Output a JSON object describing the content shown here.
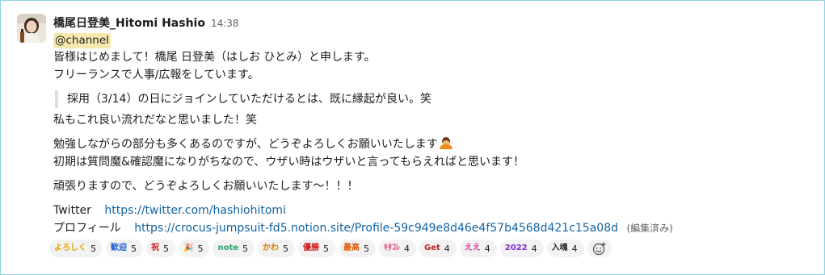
{
  "message": {
    "author": "橋尾日登美_Hitomi Hashio",
    "time": "14:38",
    "mention": "@channel",
    "lines1": [
      "皆様はじめまして！橋尾 日登美（はしお ひとみ）と申します。",
      "フリーランスで人事/広報をしています。"
    ],
    "quote": "採用（3/14）の日にジョインしていただけるとは、既に縁起が良い。笑",
    "after_quote": "私もこれ良い流れだなと思いました！笑",
    "para2_line1": "勉強しながらの部分も多くあるのですが、どうぞよろしくお願いいたします",
    "para2_line2": "初期は質問魔&確認魔になりがちなので、ウザい時はウザいと言ってもらえればと思います！",
    "para3": "頑張りますので、どうぞよろしくお願いいたします〜！！！",
    "twitter_label": "Twitter",
    "twitter_url": "https://twitter.com/hashiohitomi",
    "profile_label": "プロフィール",
    "profile_url": "https://crocus-jumpsuit-fd5.notion.site/Profile-59c949e8d46e4f57b4568d421c15a08d",
    "edited": "(編集済み)"
  },
  "reactions": [
    {
      "label": "よろしく",
      "count": "5",
      "color": "#e0a100",
      "icon": "yoroshiku-emoji"
    },
    {
      "label": "歓迎",
      "count": "5",
      "color": "#1a5fd6",
      "icon": "kangei-emoji"
    },
    {
      "label": "祝",
      "count": "5",
      "color": "#d11a1a",
      "icon": "iwai-emoji"
    },
    {
      "label": "🎉",
      "count": "5",
      "color": "#c2185b",
      "icon": "party-popper-emoji"
    },
    {
      "label": "note",
      "count": "5",
      "color": "#2aa36b",
      "icon": "note-emoji"
    },
    {
      "label": "かわ",
      "count": "5",
      "color": "#e07b00",
      "icon": "kawaii-emoji"
    },
    {
      "label": "優勝",
      "count": "5",
      "color": "#d11a1a",
      "icon": "yusho-emoji"
    },
    {
      "label": "最高",
      "count": "5",
      "color": "#e05a00",
      "icon": "saiko-emoji"
    },
    {
      "label": "ｷﾀｺﾚ",
      "count": "4",
      "color": "#e0457b",
      "icon": "kitakore-emoji"
    },
    {
      "label": "Get",
      "count": "4",
      "color": "#c81e1e",
      "icon": "get-emoji"
    },
    {
      "label": "ええ",
      "count": "4",
      "color": "#d6409f",
      "icon": "ee-emoji"
    },
    {
      "label": "2022",
      "count": "4",
      "color": "#7b2bd6",
      "icon": "2022-emoji"
    },
    {
      "label": "入魂",
      "count": "4",
      "color": "#222222",
      "icon": "nyukon-emoji"
    }
  ]
}
